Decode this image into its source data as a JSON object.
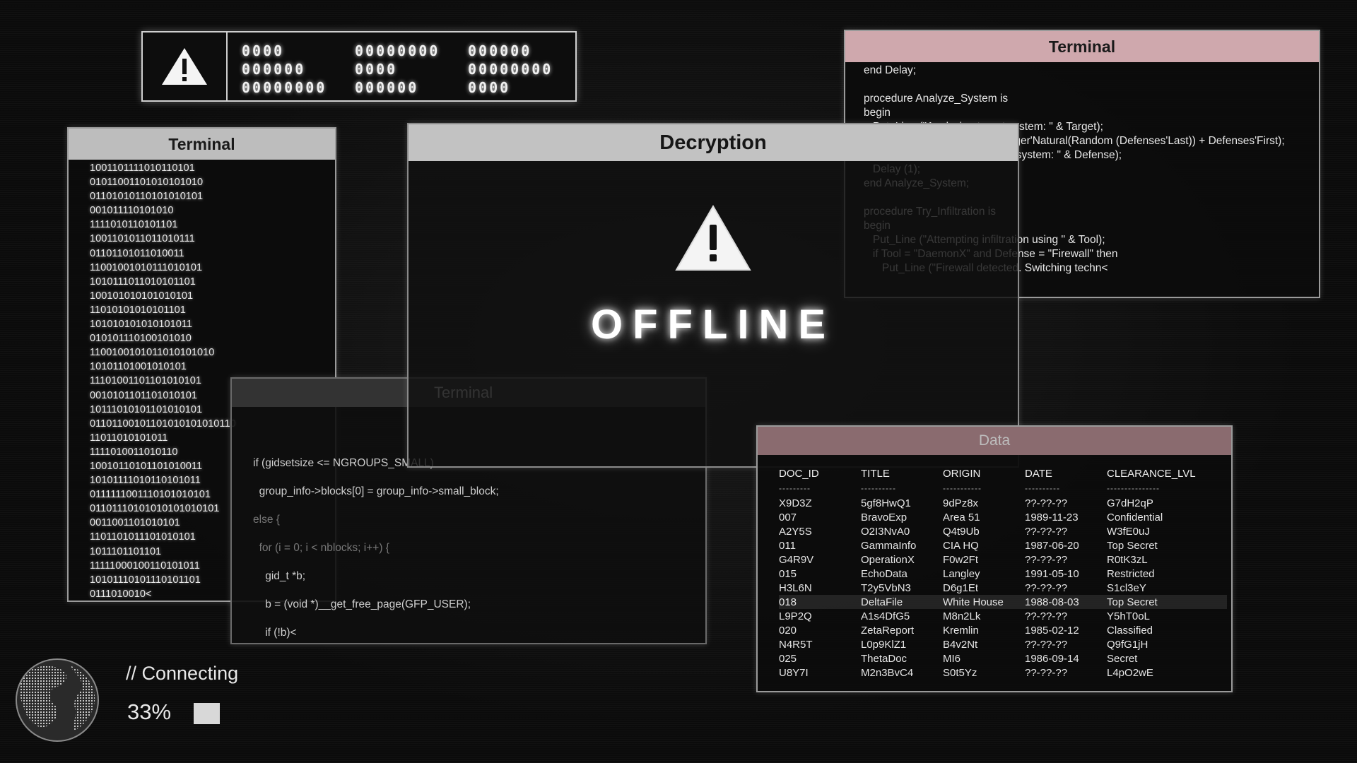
{
  "alert_banner": {
    "icon": "warning-icon",
    "codes": [
      "0000",
      "00000000",
      "000000",
      "000000",
      "0000",
      "00000000",
      "00000000",
      "000000",
      "0000"
    ]
  },
  "terminal_left": {
    "title": "Terminal",
    "lines": [
      "1001101111010110101",
      "01011001101010101010",
      "01101010110101010101",
      "001011110101010",
      "1111010110101101",
      "1001101011011010111",
      "01101101011010011",
      "11001001010111010101",
      "1010111011010101101",
      "100101010101010101",
      "11010101010101101",
      "101010101010101011",
      "010101110100101010",
      "1100100101011010101010",
      "10101101001010101",
      "11101001101101010101",
      "0010101101101010101",
      "10111010101101010101",
      "01101100101101010101010110",
      "11011010101011",
      "1111010011010110",
      "10010110101101010011",
      "10101111010110101011",
      "0111111001110101010101",
      "01101110101010101010101",
      "0011001101010101",
      "1101101011101010101",
      "1011101101101",
      "11111000100110101011",
      "10101110101110101101",
      "0111010010<"
    ]
  },
  "terminal_mid": {
    "title": "Terminal",
    "lines": [
      "if (gidsetsize <= NGROUPS_SMALL)",
      "  group_info->blocks[0] = group_info->small_block;",
      "else {",
      "  for (i = 0; i < nblocks; i++) {",
      "    gid_t *b;",
      "    b = (void *)__get_free_page(GFP_USER);",
      "    if (!b)<"
    ]
  },
  "terminal_right": {
    "title": "Terminal",
    "lines": [
      "end Delay;",
      "",
      "procedure Analyze_System is",
      "begin",
      "   Put_Line (\"Analyzing target system: \" & Target);",
      "   Defense := Defenses'Val(Integer'Natural(Random (Defenses'Last)) + Defenses'First);",
      "   Put_Line (\"Identified defense system: \" & Defense);",
      "   Delay (1);",
      "end Analyze_System;",
      "",
      "procedure Try_Infiltration is",
      "begin",
      "   Put_Line (\"Attempting infiltration using \" & Tool);",
      "   if Tool = \"DaemonX\" and Defense = \"Firewall\" then",
      "      Put_Line (\"Firewall detected. Switching techn<"
    ]
  },
  "decryption": {
    "title": "Decryption",
    "status": "OFFLINE",
    "icon": "warning-icon"
  },
  "data_window": {
    "title": "Data",
    "columns": [
      "DOC_ID",
      "TITLE",
      "ORIGIN",
      "DATE",
      "CLEARANCE_LVL"
    ],
    "separator": [
      "---------",
      "----------",
      "-----------",
      "----------",
      "---------------"
    ],
    "rows": [
      [
        "X9D3Z",
        "5gf8HwQ1",
        "9dPz8x",
        "??-??-??",
        "G7dH2qP"
      ],
      [
        "007",
        "BravoExp",
        "Area 51",
        "1989-11-23",
        "Confidential"
      ],
      [
        "A2Y5S",
        "O2I3NvA0",
        "Q4t9Ub",
        "??-??-??",
        "W3fE0uJ"
      ],
      [
        "011",
        "GammaInfo",
        "CIA HQ",
        "1987-06-20",
        "Top Secret"
      ],
      [
        "G4R9V",
        "OperationX",
        "F0w2Ft",
        "??-??-??",
        "R0tK3zL"
      ],
      [
        "015",
        "EchoData",
        "Langley",
        "1991-05-10",
        "Restricted"
      ],
      [
        "H3L6N",
        "T2y5VbN3",
        "D6g1Et",
        "??-??-??",
        "S1cl3eY"
      ],
      [
        "018",
        "DeltaFile",
        "White House",
        "1988-08-03",
        "Top Secret"
      ],
      [
        "L9P2Q",
        "A1s4DfG5",
        "M8n2Lk",
        "??-??-??",
        "Y5hT0oL"
      ],
      [
        "020",
        "ZetaReport",
        "Kremlin",
        "1985-02-12",
        "Classified"
      ],
      [
        "N4R5T",
        "L0p9KlZ1",
        "B4v2Nt",
        "??-??-??",
        "Q9fG1jH"
      ],
      [
        "025",
        "ThetaDoc",
        "MI6",
        "1986-09-14",
        "Secret"
      ],
      [
        "U8Y7I",
        "M2n3BvC4",
        "S0t5Yz",
        "??-??-??",
        "L4pO2wE"
      ]
    ],
    "highlight_row": 7
  },
  "connecting": {
    "label": "// Connecting",
    "percent": "33%",
    "progress": 0.33,
    "icon": "globe-icon"
  }
}
